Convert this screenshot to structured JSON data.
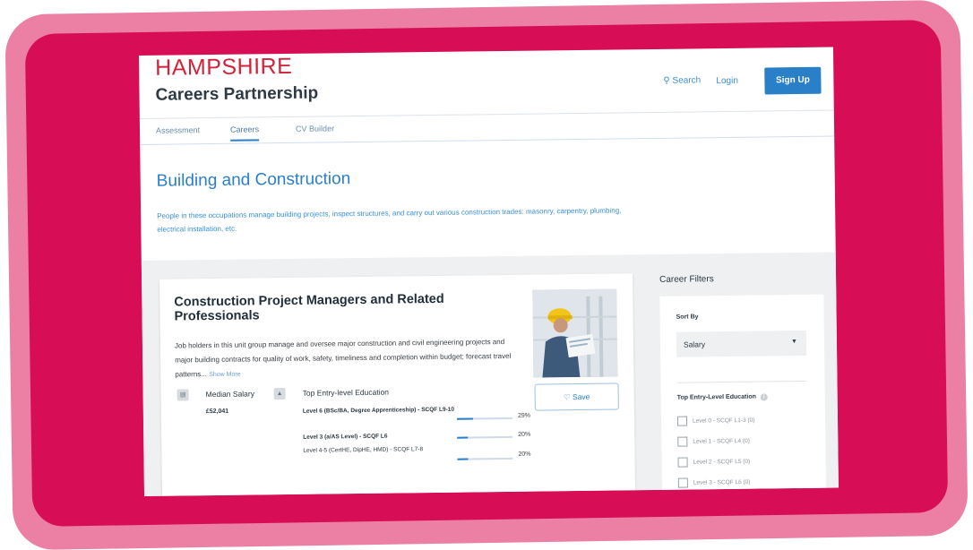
{
  "brand": {
    "name_top": "HAMPSHIRE",
    "name_bottom": "Careers Partnership"
  },
  "header": {
    "search_label": "Search",
    "login_label": "Login",
    "signup_label": "Sign Up"
  },
  "tabs": [
    {
      "label": "Assessment"
    },
    {
      "label": "Careers"
    },
    {
      "label": "CV Builder"
    }
  ],
  "page": {
    "title": "Building and Construction",
    "description": "People in these occupations manage building projects, inspect structures, and carry out various construction trades: masonry, carpentry, plumbing, electrical installation, etc."
  },
  "career_card": {
    "title": "Construction Project Managers and Related Professionals",
    "description": "Job holders in this unit group manage and oversee major construction and civil engineering projects and major building contracts for quality of work, safety, timeliness and completion within budget; forecast travel patterns...",
    "show_more": "Show More",
    "save_label": "Save",
    "salary_label": "Median Salary",
    "salary_value": "£52,041",
    "education_label": "Top Entry-level Education",
    "education": [
      {
        "label": "Level 6 (BSc/BA, Degree Apprenticeship) - SCQF L9-10",
        "percent": "29%",
        "fraction": 0.29
      },
      {
        "label": "Level 3 (a/AS Level) - SCQF L6",
        "percent": "20%",
        "fraction": 0.2
      },
      {
        "label": "Level 4-5 (CertHE, DipHE, HMD) - SCQF L7-8",
        "percent": "20%",
        "fraction": 0.2
      }
    ]
  },
  "filters": {
    "title": "Career Filters",
    "sort_label": "Sort By",
    "sort_value": "Salary",
    "education_label": "Top Entry-Level Education",
    "education_options": [
      {
        "label": "Level 0 - SCQF L1-3 (0)"
      },
      {
        "label": "Level 1 - SCQF L4 (0)"
      },
      {
        "label": "Level 2 - SCQF L5 (0)"
      },
      {
        "label": "Level 3 - SCQF L6 (0)"
      }
    ]
  },
  "colors": {
    "frame_outer": "#ec7fa4",
    "frame_inner": "#d70e55",
    "accent": "#2a7fc9",
    "brand_red": "#d2233c"
  }
}
